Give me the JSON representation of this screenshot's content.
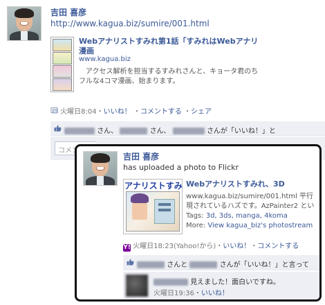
{
  "back_post": {
    "author": "吉田 喜彦",
    "url": "http://www.kagua.biz/sumire/001.html",
    "link": {
      "title_line1": "Webアナリストすみれ第1話「すみれはWebアナリ",
      "title_line2": "漫画",
      "domain": "www.kagua.biz",
      "desc_line1": "　アクセス解析を担当するすみれさんと、キョータ君のち",
      "desc_line2": "フルな4コマ漫画、始まります。"
    },
    "meta": {
      "time": "火曜日8:04",
      "sep1": "・",
      "like": "いいね！",
      "sep2": "・",
      "comment": "コメントする",
      "sep3": "・",
      "share": "シェア"
    },
    "likes": {
      "san1": "さん、",
      "san2": "さん、",
      "san3": "さんが「いいね！」と"
    },
    "comment_placeholder": "コメン"
  },
  "front_post": {
    "author": "吉田 喜彦",
    "action": "has uploaded a photo to Flickr",
    "photo_text": "アナリストすみ",
    "photo": {
      "title": "Webアナリストすみれ、3D",
      "desc_line1": "www.kagua.biz/sumire/001.html 平行",
      "desc_line2": "現されているハズです。AzPainter2 とい",
      "tags_label": "Tags:",
      "tags": "3d, 3ds, manga, 4koma",
      "more_label": "More:",
      "more_link": "View kagua_biz's photostream"
    },
    "meta": {
      "time": "火曜日18:23",
      "via": "(Yahoo!から)",
      "sep1": "・",
      "like": "いいね！",
      "sep2": "・",
      "comment": "コメントする"
    },
    "likes": {
      "mid": "さんと",
      "tail": "さんが「いいね！」と言って"
    },
    "comment": {
      "text": "見えました！面白いですね。",
      "time": "火曜日19:36",
      "sep": "・",
      "like": "いいね！"
    }
  },
  "icons": {
    "yahoo": "Y!"
  },
  "colors": {
    "link": "#3b5998",
    "likes_bg": "#edeff4",
    "highlight_border": "#111111",
    "yahoo": "#7b0099"
  }
}
